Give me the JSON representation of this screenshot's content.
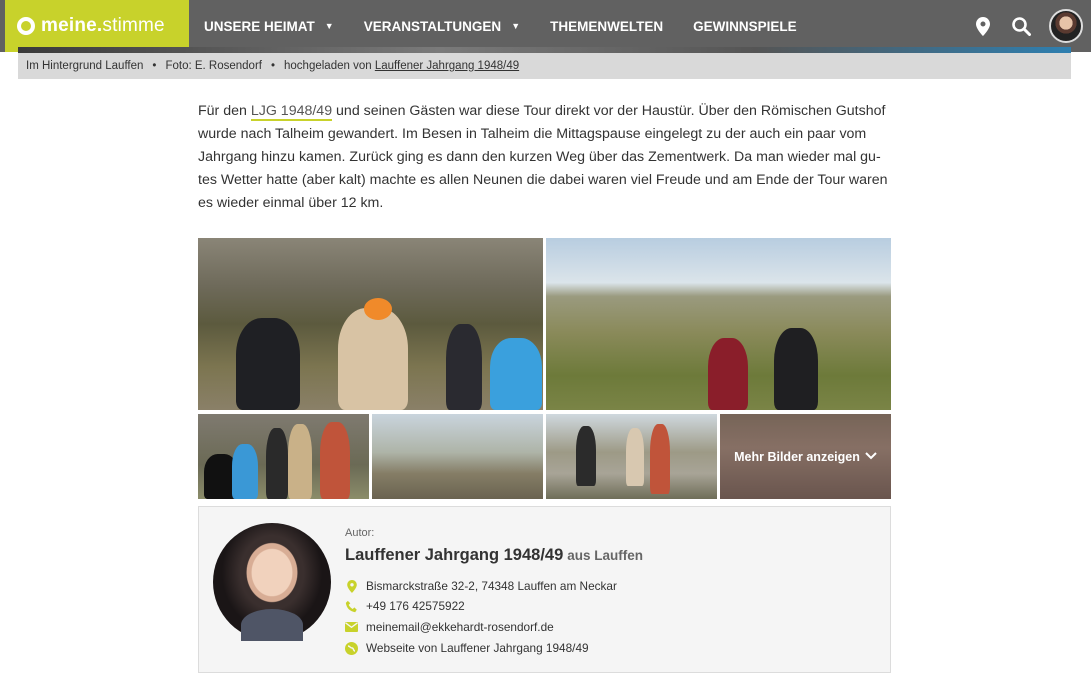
{
  "header": {
    "logo_bold": "meine.",
    "logo_light": "stimme",
    "nav": [
      {
        "label": "UNSERE HEIMAT",
        "has_caret": true
      },
      {
        "label": "VERANSTALTUNGEN",
        "has_caret": true
      },
      {
        "label": "THEMENWELTEN",
        "has_caret": false
      },
      {
        "label": "GEWINNSPIELE",
        "has_caret": false
      }
    ],
    "icons": [
      "location-icon",
      "search-icon",
      "user-avatar"
    ],
    "colors": {
      "bar": "#616161",
      "brand": "#c8d22b"
    }
  },
  "caption": {
    "background": "Im Hintergrund Lauffen",
    "photo": "Foto: E. Rosendorf",
    "uploaded_prefix": "hochgeladen von",
    "uploaded_by": "Lauffener Jahrgang 1948/49"
  },
  "article": {
    "prefix": "Für den ",
    "link": "LJG 1948/49",
    "text": " und seinen Gästen war diese Tour direkt vor der Haustür. Über den Römischen Gutshof wurde nach Talheim gewandert. Im Besen in Talheim die Mittagspause eingelegt zu der auch ein paar vom Jahrgang hinzu kamen. Zurück ging es dann den kurzen Weg über das Zementwerk. Da man wieder mal gu­tes Wetter hatte (aber kalt) machte es allen Neunen die dabei waren viel Freude und am Ende der Tour waren es wieder einmal über 12 km."
  },
  "gallery": {
    "more_label": "Mehr Bilder anzeigen"
  },
  "author": {
    "label": "Autor:",
    "name": "Lauffener Jahrgang 1948/49",
    "from": "aus Lauffen",
    "address": "Bismarckstraße 32-2, 74348 Lauffen am Neckar",
    "phone": "+49 176 42575922",
    "email": "meinemail@ekkehardt-rosendorf.de",
    "website": "Webseite von Lauffener Jahrgang 1948/49"
  }
}
